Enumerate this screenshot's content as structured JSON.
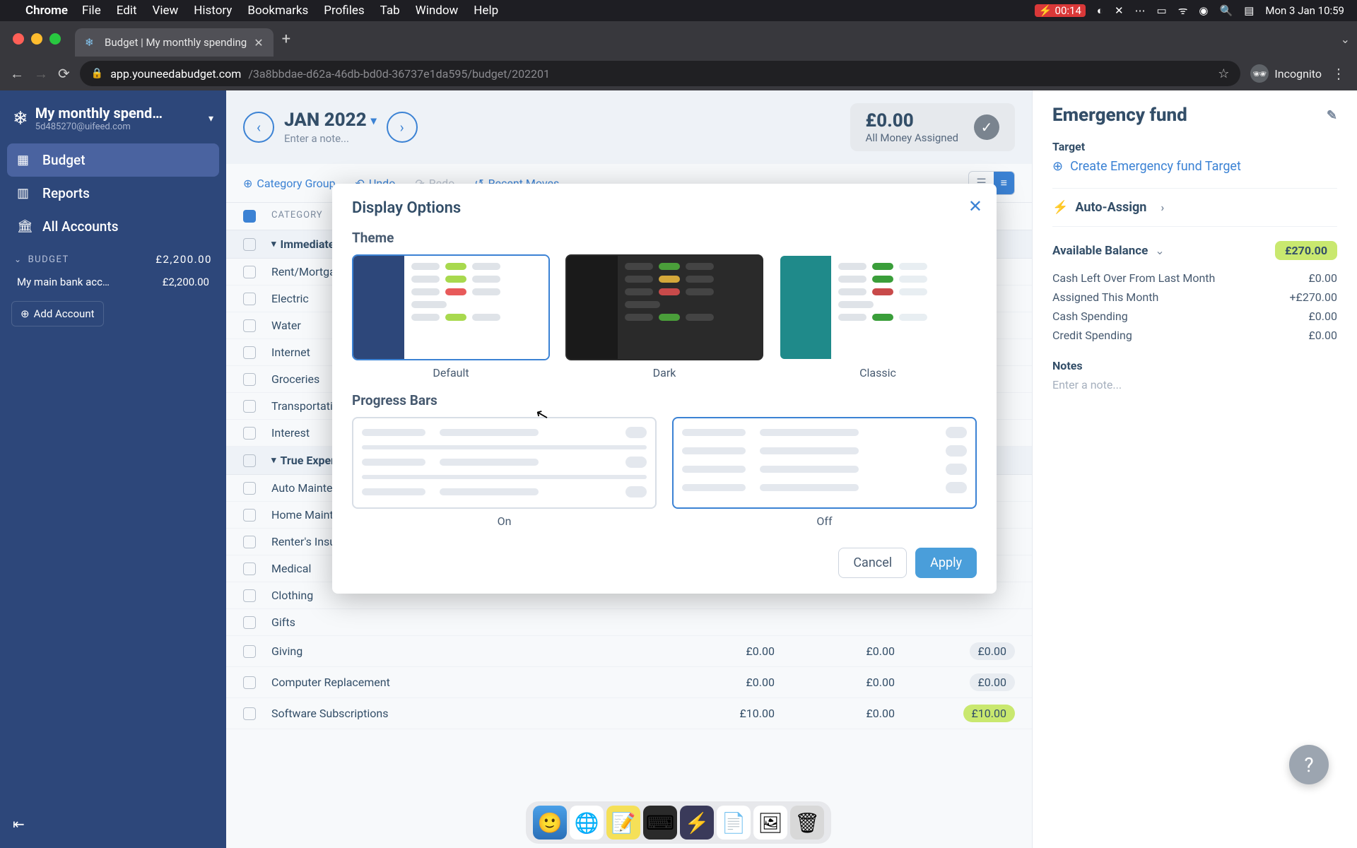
{
  "menubar": {
    "app": "Chrome",
    "items": [
      "File",
      "Edit",
      "View",
      "History",
      "Bookmarks",
      "Profiles",
      "Tab",
      "Window",
      "Help"
    ],
    "battery": "00:14",
    "datetime": "Mon 3 Jan  10:59"
  },
  "browser": {
    "tab_title": "Budget | My monthly spending",
    "url_domain": "app.youneedabudget.com",
    "url_path": "/3a8bbdae-d62a-46db-bd0d-36737e1da595/budget/202201",
    "incognito": "Incognito"
  },
  "sidebar": {
    "title": "My monthly spend…",
    "email": "5d485270@uifeed.com",
    "nav": [
      {
        "label": "Budget",
        "icon": "💰"
      },
      {
        "label": "Reports",
        "icon": "📊"
      },
      {
        "label": "All Accounts",
        "icon": "🏛"
      }
    ],
    "section": {
      "label": "BUDGET",
      "amount": "£2,200.00"
    },
    "account": {
      "name": "My main bank acc…",
      "amount": "£2,200.00"
    },
    "add_account": "Add Account"
  },
  "header": {
    "month": "JAN 2022",
    "note_placeholder": "Enter a note...",
    "assigned_amount": "£0.00",
    "assigned_label": "All Money Assigned"
  },
  "toolbar": {
    "category_group": "Category Group",
    "undo": "Undo",
    "redo": "Redo",
    "recent": "Recent Moves"
  },
  "table_header": "CATEGORY",
  "groups": [
    {
      "name": "Immediate",
      "rows": [
        {
          "name": "Rent/Mortgage"
        },
        {
          "name": "Electric"
        },
        {
          "name": "Water"
        },
        {
          "name": "Internet"
        },
        {
          "name": "Groceries"
        },
        {
          "name": "Transportation"
        },
        {
          "name": "Interest"
        }
      ]
    },
    {
      "name": "True Expenses",
      "rows": [
        {
          "name": "Auto Maintenance"
        },
        {
          "name": "Home Maintenance"
        },
        {
          "name": "Renter's Insurance"
        },
        {
          "name": "Medical"
        },
        {
          "name": "Clothing"
        },
        {
          "name": "Gifts"
        },
        {
          "name": "Giving",
          "a": "£0.00",
          "b": "£0.00",
          "c": "£0.00",
          "pill": "gray"
        },
        {
          "name": "Computer Replacement",
          "a": "£0.00",
          "b": "£0.00",
          "c": "£0.00",
          "pill": "gray"
        },
        {
          "name": "Software Subscriptions",
          "a": "£10.00",
          "b": "£0.00",
          "c": "£10.00",
          "pill": "green"
        }
      ]
    }
  ],
  "right": {
    "title": "Emergency fund",
    "target_label": "Target",
    "create_target": "Create Emergency fund Target",
    "auto_assign": "Auto-Assign",
    "available_label": "Available Balance",
    "available_amount": "£270.00",
    "details": [
      {
        "l": "Cash Left Over From Last Month",
        "v": "£0.00"
      },
      {
        "l": "Assigned This Month",
        "v": "+£270.00"
      },
      {
        "l": "Cash Spending",
        "v": "£0.00"
      },
      {
        "l": "Credit Spending",
        "v": "£0.00"
      }
    ],
    "notes_label": "Notes",
    "notes_placeholder": "Enter a note..."
  },
  "modal": {
    "title": "Display Options",
    "theme_label": "Theme",
    "themes": [
      "Default",
      "Dark",
      "Classic"
    ],
    "progress_label": "Progress Bars",
    "progress_options": [
      "On",
      "Off"
    ],
    "cancel": "Cancel",
    "apply": "Apply"
  }
}
